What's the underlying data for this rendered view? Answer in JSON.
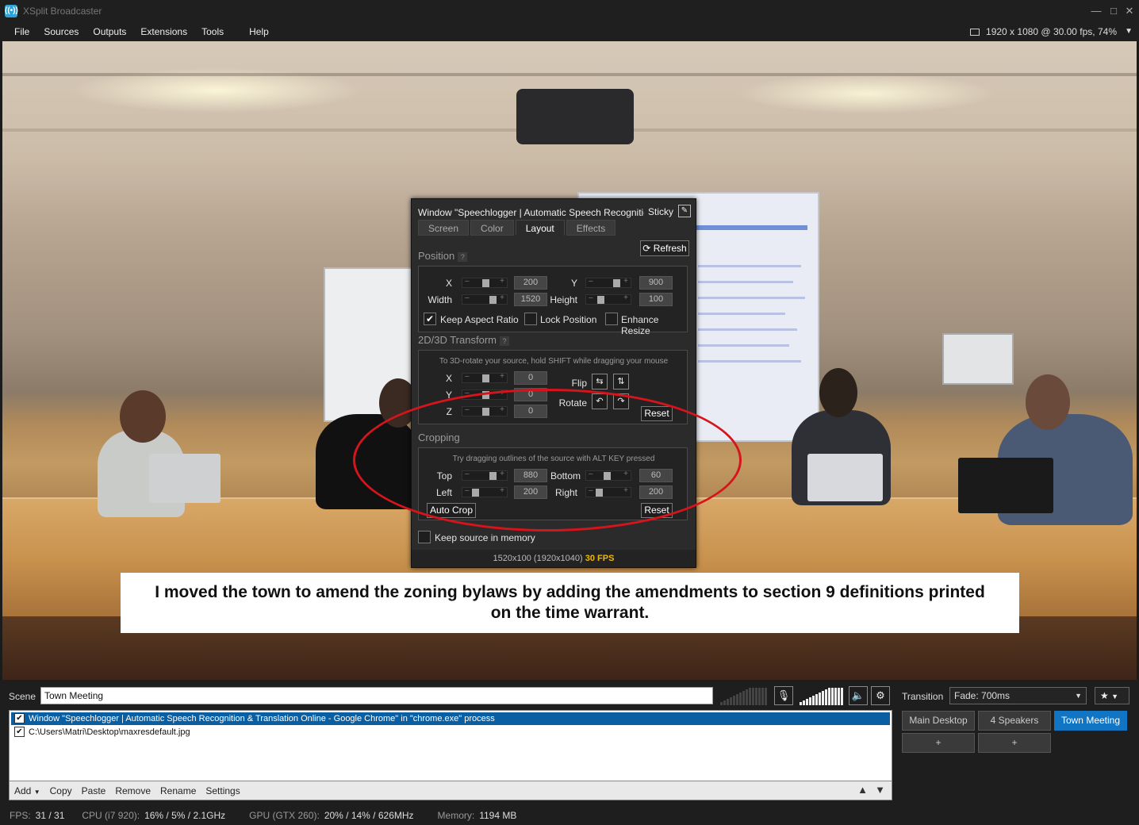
{
  "window": {
    "title": "XSplit Broadcaster",
    "icon": "broadcast-icon"
  },
  "menu": {
    "items": [
      "File",
      "Sources",
      "Outputs",
      "Extensions",
      "Tools",
      "Help"
    ]
  },
  "resolution": {
    "text": "1920 x 1080 @ 30.00 fps, 74%"
  },
  "caption": {
    "text": "I moved the town to amend the zoning bylaws by adding the amendments to section 9 definitions printed on the time warrant."
  },
  "dialog": {
    "title": "Window \"Speechlogger | Automatic Speech Recognitio...",
    "sticky_label": "Sticky",
    "tabs": [
      "Screen",
      "Color",
      "Layout",
      "Effects"
    ],
    "active_tab": "Layout",
    "refresh_label": "Refresh",
    "position": {
      "label": "Position",
      "x_label": "X",
      "x_value": "200",
      "y_label": "Y",
      "y_value": "900",
      "width_label": "Width",
      "width_value": "1520",
      "height_label": "Height",
      "height_value": "100",
      "keep_aspect_label": "Keep Aspect Ratio",
      "keep_aspect_checked": true,
      "lock_position_label": "Lock Position",
      "enhance_resize_label": "Enhance Resize"
    },
    "transform": {
      "label": "2D/3D Transform",
      "hint": "To 3D-rotate your source, hold SHIFT while dragging your mouse",
      "x_label": "X",
      "x_value": "0",
      "y_label": "Y",
      "y_value": "0",
      "z_label": "Z",
      "z_value": "0",
      "flip_label": "Flip",
      "rotate_label": "Rotate",
      "reset_label": "Reset"
    },
    "cropping": {
      "label": "Cropping",
      "hint": "Try dragging outlines of the source with ALT KEY pressed",
      "top_label": "Top",
      "top_value": "880",
      "bottom_label": "Bottom",
      "bottom_value": "60",
      "left_label": "Left",
      "left_value": "200",
      "right_label": "Right",
      "right_value": "200",
      "autocrop_label": "Auto Crop",
      "reset_label": "Reset"
    },
    "keep_memory_label": "Keep source in memory",
    "status_dims": "1520x100 (1920x1040)",
    "status_fps": "30 FPS"
  },
  "bottom": {
    "scene_label": "Scene",
    "scene_name": "Town Meeting",
    "sources": [
      {
        "label": "Window \"Speechlogger | Automatic Speech Recognition & Translation Online - Google Chrome\" in \"chrome.exe\" process",
        "checked": true,
        "selected": true
      },
      {
        "label": "C:\\Users\\Matri\\Desktop\\maxresdefault.jpg",
        "checked": true,
        "selected": false
      }
    ],
    "source_tools": [
      "Add",
      "Copy",
      "Paste",
      "Remove",
      "Rename",
      "Settings"
    ],
    "transition_label": "Transition",
    "transition_value": "Fade: 700ms",
    "scenes": [
      "Main Desktop",
      "4 Speakers",
      "Town Meeting"
    ],
    "active_scene": "Town Meeting",
    "add_scene_label": "+"
  },
  "status": {
    "fps_label": "FPS:",
    "fps_value": "31 / 31",
    "cpu_label": "CPU (i7 920):",
    "cpu_value": "16% / 5% / 2.1GHz",
    "gpu_label": "GPU (GTX 260):",
    "gpu_value": "20% / 14% / 626MHz",
    "mem_label": "Memory:",
    "mem_value": "1194 MB"
  },
  "colors": {
    "accent": "#1275c4",
    "selection": "#0a5fa3",
    "fps_highlight": "#f0b800",
    "annotation": "#d6141b"
  }
}
